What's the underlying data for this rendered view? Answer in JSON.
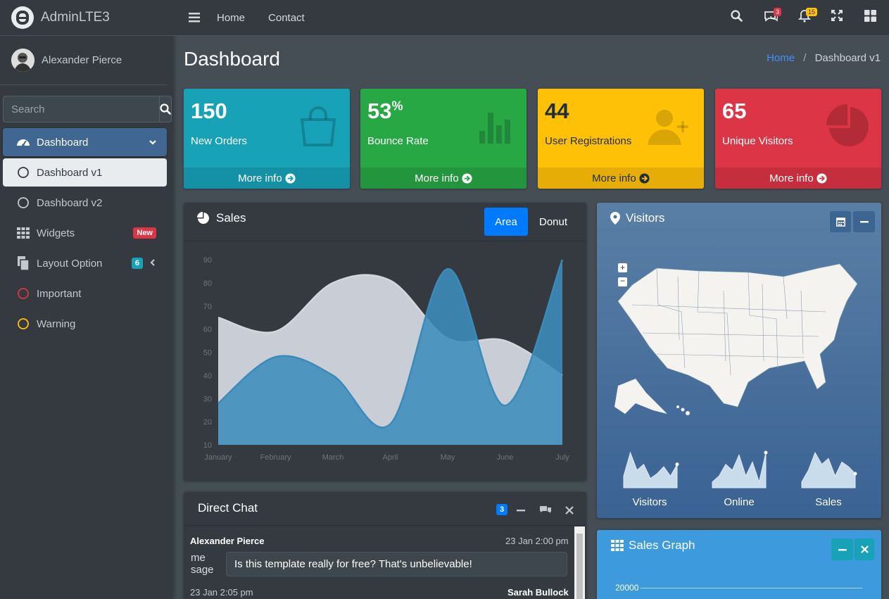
{
  "brand": {
    "name": "AdminLTE3"
  },
  "user": {
    "name": "Alexander Pierce"
  },
  "search": {
    "placeholder": "Search"
  },
  "sidebar": {
    "items": [
      {
        "label": "Dashboard",
        "icon": "tachometer-icon"
      },
      {
        "label": "Dashboard v1",
        "icon": "circle-icon"
      },
      {
        "label": "Dashboard v2",
        "icon": "circle-icon"
      },
      {
        "label": "Widgets",
        "icon": "grid-icon",
        "badge": "New"
      },
      {
        "label": "Layout Option",
        "icon": "copy-icon",
        "badge": "6"
      },
      {
        "label": "Important",
        "icon": "circle-icon"
      },
      {
        "label": "Warning",
        "icon": "circle-icon"
      }
    ]
  },
  "topnav": {
    "home": "Home",
    "contact": "Contact",
    "messages_count": "3",
    "notifications_count": "15"
  },
  "page": {
    "title": "Dashboard",
    "breadcrumb_home": "Home",
    "breadcrumb_current": "Dashboard v1"
  },
  "stats": [
    {
      "value": "150",
      "suffix": "",
      "label": "New Orders",
      "footer": "More info",
      "color": "#17a2b8",
      "icon": "shopping-bag-icon"
    },
    {
      "value": "53",
      "suffix": "%",
      "label": "Bounce Rate",
      "footer": "More info",
      "color": "#28a745",
      "icon": "bar-chart-icon"
    },
    {
      "value": "44",
      "suffix": "",
      "label": "User Registrations",
      "footer": "More info",
      "color": "#ffc107",
      "icon": "user-plus-icon"
    },
    {
      "value": "65",
      "suffix": "",
      "label": "Unique Visitors",
      "footer": "More info",
      "color": "#dc3545",
      "icon": "pie-chart-icon"
    }
  ],
  "sales": {
    "title": "Sales",
    "tab_area": "Area",
    "tab_donut": "Donut"
  },
  "chart_data": {
    "type": "area",
    "categories": [
      "January",
      "February",
      "March",
      "April",
      "May",
      "June",
      "July"
    ],
    "series": [
      {
        "values": [
          65,
          59,
          80,
          81,
          56,
          55,
          40
        ],
        "color": "#d2d6de"
      },
      {
        "values": [
          28,
          48,
          40,
          19,
          86,
          27,
          90
        ],
        "color": "#3c8dbc"
      }
    ],
    "yticks": [
      10,
      20,
      30,
      40,
      50,
      60,
      70,
      80,
      90
    ],
    "ylim": [
      10,
      90
    ]
  },
  "visitors": {
    "title": "Visitors",
    "sparks": [
      {
        "label": "Visitors",
        "values": [
          10,
          30,
          15,
          20,
          8,
          12,
          18,
          10,
          20
        ]
      },
      {
        "label": "Online",
        "values": [
          5,
          10,
          20,
          15,
          28,
          10,
          22,
          5,
          30
        ]
      },
      {
        "label": "Sales",
        "values": [
          5,
          15,
          30,
          20,
          25,
          10,
          22,
          18,
          12
        ]
      }
    ]
  },
  "chat": {
    "title": "Direct Chat",
    "count": "3",
    "msg1_name": "Alexander Pierce",
    "msg1_time": "23 Jan 2:00 pm",
    "msg1_text": "Is this template really for free? That's unbelievable!",
    "msg2_time": "23 Jan 2:05 pm",
    "msg2_name": "Sarah Bullock",
    "img_alt": "me sage"
  },
  "sales_graph": {
    "title": "Sales Graph",
    "tick": "20000"
  }
}
